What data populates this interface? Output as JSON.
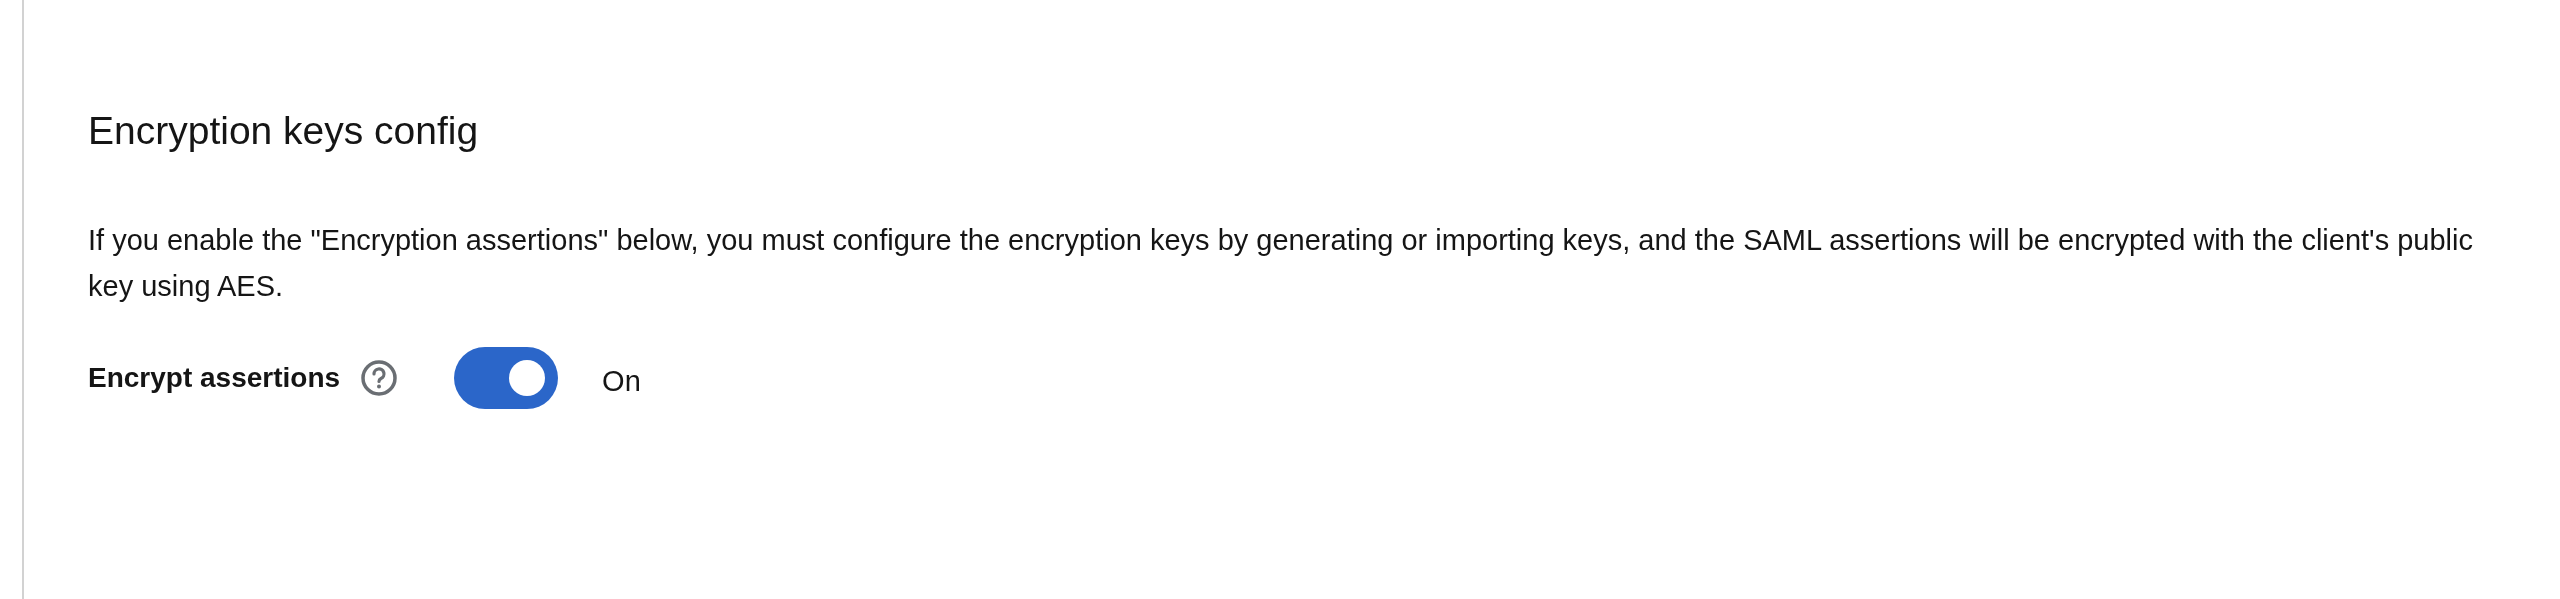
{
  "section": {
    "title": "Encryption keys config",
    "description": "If you enable the \"Encryption assertions\" below, you must configure the encryption keys by generating or importing keys, and the SAML assertions will be encrypted with the client's public key using AES."
  },
  "fields": [
    {
      "label": "Encrypt assertions",
      "kind": "switch",
      "on": true,
      "state_label": "On"
    }
  ]
}
